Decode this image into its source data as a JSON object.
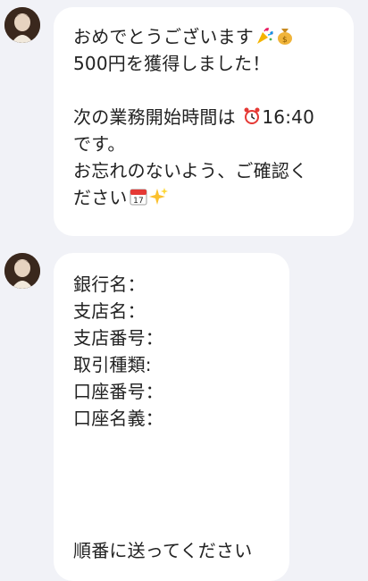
{
  "messages": [
    {
      "lines": [
        "おめでとうございます",
        "500円を獲得しました！",
        "",
        "次の業務開始時間は",
        "です。",
        "お忘れのないよう、ご確認く",
        "ださい"
      ],
      "alarm_time": "16:40",
      "emoji": [
        "party-popper",
        "money-bag",
        "alarm-clock",
        "calendar",
        "sparkles"
      ]
    },
    {
      "lines": [
        "銀行名：",
        "支店名：",
        "支店番号：",
        "取引種類:",
        "口座番号：",
        "口座名義："
      ],
      "footer": "順番に送ってください"
    }
  ]
}
